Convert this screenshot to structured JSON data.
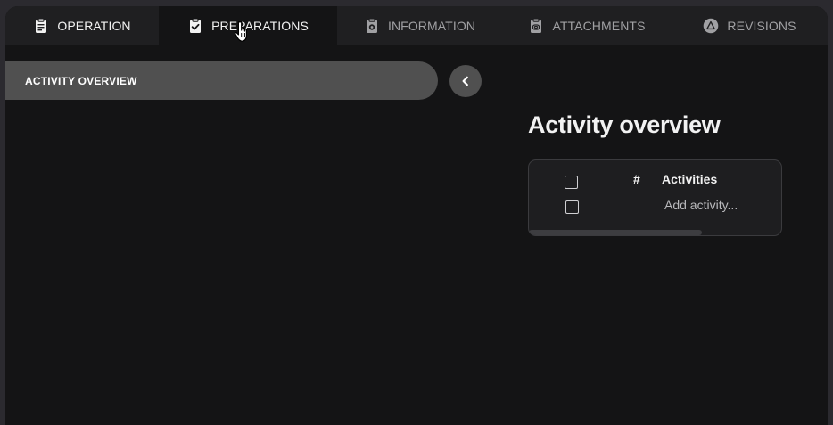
{
  "tabs": [
    {
      "label": "OPERATION",
      "icon": "clipboard-icon"
    },
    {
      "label": "PREPARATIONS",
      "icon": "clipboard-check-icon"
    },
    {
      "label": "INFORMATION",
      "icon": "clipboard-settings-icon"
    },
    {
      "label": "ATTACHMENTS",
      "icon": "clipboard-attachment-icon"
    },
    {
      "label": "REVISIONS",
      "icon": "revision-triangle-icon"
    }
  ],
  "active_tab": "PREPARATIONS",
  "sidebar": {
    "pill_label": "ACTIVITY OVERVIEW",
    "collapse_icon": "chevron-left-icon"
  },
  "main": {
    "title": "Activity overview",
    "table": {
      "columns": [
        "#",
        "Activities"
      ],
      "add_placeholder": "Add activity..."
    }
  },
  "colors": {
    "window_bg": "#141415",
    "tabbar_bg": "#1f1f21",
    "pill_bg": "#505050",
    "card_bg": "#1e1e20",
    "text_primary": "#f2f2f2",
    "text_muted": "#a0a0a3"
  }
}
